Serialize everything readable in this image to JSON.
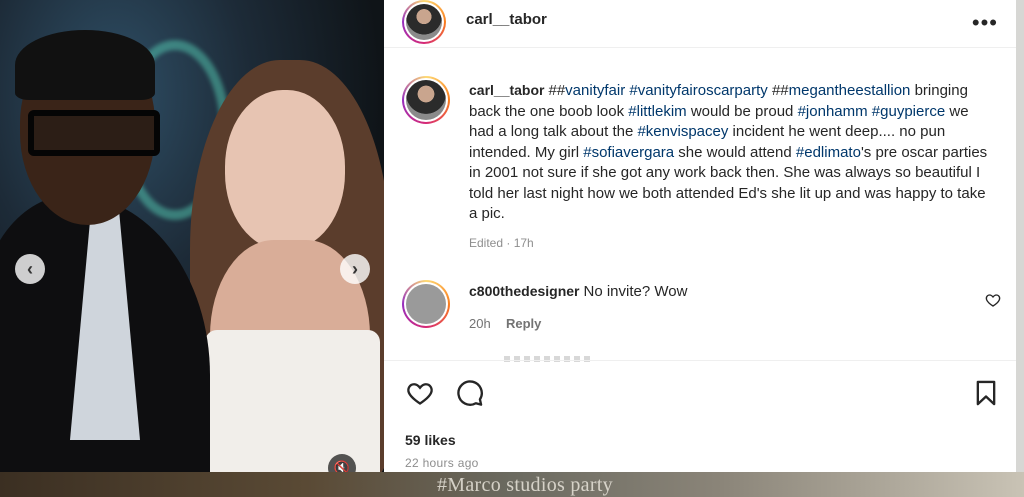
{
  "post": {
    "username": "carl__tabor",
    "caption_parts": [
      {
        "t": "##",
        "tag": false
      },
      {
        "t": "vanityfair",
        "tag": true
      },
      {
        "t": " ",
        "tag": false
      },
      {
        "t": "#vanityfairoscarparty",
        "tag": true
      },
      {
        "t": " ##",
        "tag": false
      },
      {
        "t": "megantheestallion",
        "tag": true
      },
      {
        "t": " bringing back the one boob look ",
        "tag": false
      },
      {
        "t": "#littlekim",
        "tag": true
      },
      {
        "t": " would be proud ",
        "tag": false
      },
      {
        "t": "#jonhamm",
        "tag": true
      },
      {
        "t": " ",
        "tag": false
      },
      {
        "t": "#guypierce",
        "tag": true
      },
      {
        "t": " we had a long talk about the ",
        "tag": false
      },
      {
        "t": "#kenvispacey",
        "tag": true
      },
      {
        "t": " incident he went deep.... no pun intended. My girl ",
        "tag": false
      },
      {
        "t": "#sofiavergara",
        "tag": true
      },
      {
        "t": " she would attend ",
        "tag": false
      },
      {
        "t": "#edlimato",
        "tag": true
      },
      {
        "t": "'s pre oscar parties in 2001 not sure if she got any work back then. She was always so beautiful I told her last night how we both attended Ed's she lit up and was happy to take a pic.",
        "tag": false
      }
    ],
    "edited_label": "Edited · 17h",
    "likes": "59 likes",
    "posted_time": "22 hours ago"
  },
  "comment": {
    "username": "c800thedesigner",
    "text": "No invite? Wow",
    "time": "20h",
    "reply_label": "Reply"
  },
  "media": {
    "prev_glyph": "‹",
    "next_glyph": "›",
    "audio_glyph": "🔇"
  },
  "background": {
    "overlay_text": "#Marco studios party"
  },
  "icons": {
    "more": "•••"
  }
}
